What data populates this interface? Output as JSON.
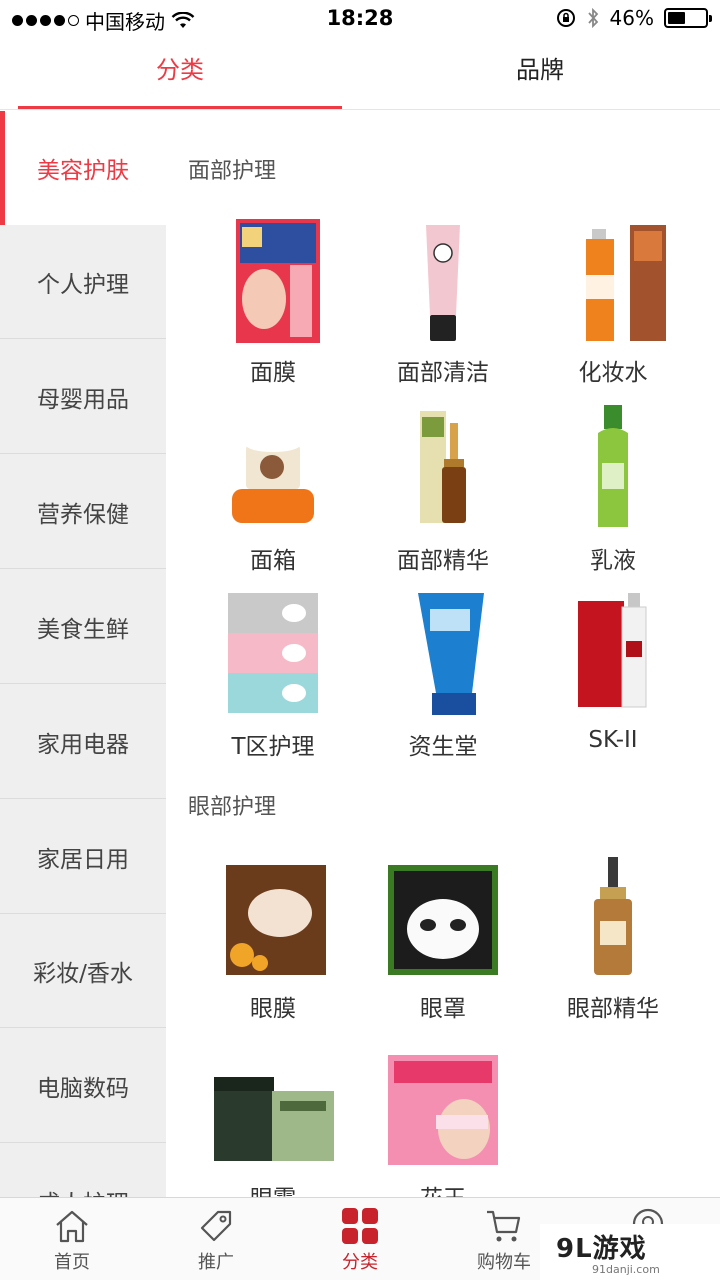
{
  "status_bar": {
    "carrier": "中国移动",
    "time": "18:28",
    "battery": "46%",
    "battery_level": 0.46
  },
  "top_tabs": [
    {
      "label": "分类",
      "active": true
    },
    {
      "label": "品牌",
      "active": false
    }
  ],
  "sidebar": {
    "items": [
      {
        "label": "美容护肤",
        "active": true
      },
      {
        "label": "个人护理"
      },
      {
        "label": "母婴用品"
      },
      {
        "label": "营养保健"
      },
      {
        "label": "美食生鲜"
      },
      {
        "label": "家用电器"
      },
      {
        "label": "家居日用"
      },
      {
        "label": "彩妆/香水"
      },
      {
        "label": "电脑数码"
      },
      {
        "label": "成人护理"
      }
    ]
  },
  "sections": [
    {
      "title": "面部护理",
      "products": [
        {
          "label": "面膜",
          "icon": "face-mask-product"
        },
        {
          "label": "面部清洁",
          "icon": "cleanser-tube"
        },
        {
          "label": "化妆水",
          "icon": "toner-bottles"
        },
        {
          "label": "面箱",
          "icon": "cream-jar"
        },
        {
          "label": "面部精华",
          "icon": "serum-dropper"
        },
        {
          "label": "乳液",
          "icon": "lotion-bottle"
        },
        {
          "label": "T区护理",
          "icon": "nose-strip-pack"
        },
        {
          "label": "资生堂",
          "icon": "blue-cleanser-tube"
        },
        {
          "label": "SK-II",
          "icon": "skii-box-bottle"
        }
      ]
    },
    {
      "title": "眼部护理",
      "products": [
        {
          "label": "眼膜",
          "icon": "eye-mask-pack"
        },
        {
          "label": "眼罩",
          "icon": "panda-eye-mask"
        },
        {
          "label": "眼部精华",
          "icon": "eye-serum-dropper"
        },
        {
          "label": "眼霜",
          "icon": "eye-cream-jars"
        },
        {
          "label": "花王",
          "icon": "steam-eye-mask"
        }
      ]
    }
  ],
  "bottom_nav": [
    {
      "label": "首页",
      "icon": "home-icon"
    },
    {
      "label": "推广",
      "icon": "tag-icon"
    },
    {
      "label": "分类",
      "icon": "category-grid-icon",
      "active": true
    },
    {
      "label": "购物车",
      "icon": "cart-icon"
    },
    {
      "label": "我的",
      "icon": "user-icon"
    }
  ],
  "watermark": {
    "main": "9L游戏",
    "sub": "91danji.com"
  },
  "colors": {
    "accent": "#ee3a44",
    "nav_active": "#c8232c",
    "sidebar_bg": "#efefef"
  }
}
